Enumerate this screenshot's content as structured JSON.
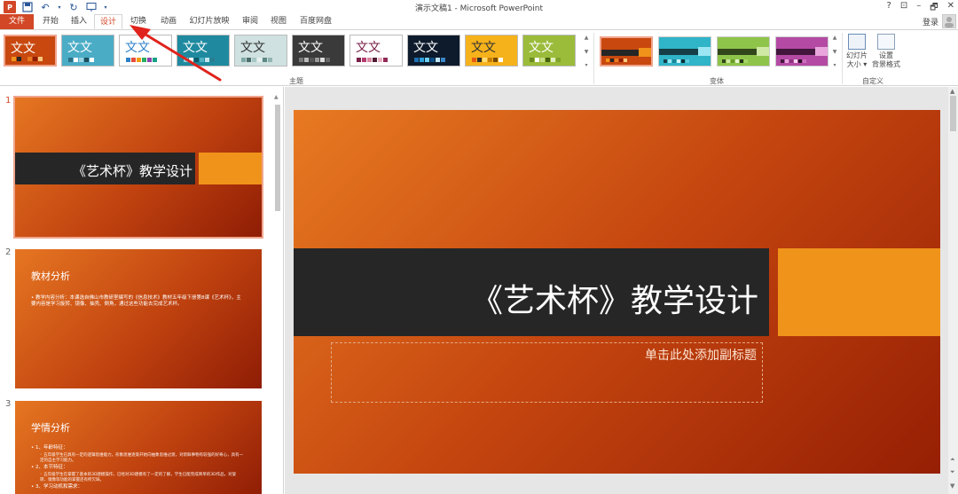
{
  "app": {
    "title": "演示文稿1 - Microsoft PowerPoint",
    "logo_text": "P",
    "window_controls": [
      "?",
      "⊡",
      "–",
      "🗗",
      "✕"
    ]
  },
  "tabs": [
    {
      "label": "文件",
      "kind": "file"
    },
    {
      "label": "开始"
    },
    {
      "label": "插入"
    },
    {
      "label": "设计",
      "active": true
    },
    {
      "label": "切换"
    },
    {
      "label": "动画"
    },
    {
      "label": "幻灯片放映"
    },
    {
      "label": "审阅"
    },
    {
      "label": "视图"
    },
    {
      "label": "百度网盘"
    }
  ],
  "account": {
    "login_label": "登录"
  },
  "ribbon": {
    "themes_group_label": "主题",
    "variants_group_label": "变体",
    "custom_group_label": "自定义",
    "theme_sample_text": "文文",
    "themes": [
      {
        "bg": "#c8480f",
        "fg": "#ffffff",
        "selected": true,
        "swatches": [
          "#f0931a",
          "#262626",
          "#c8480f",
          "#e87a22",
          "#8f1d05",
          "#f7c77f"
        ]
      },
      {
        "bg": "#4bacc6",
        "fg": "#ffffff",
        "swatches": [
          "#2c6e83",
          "#ffffff",
          "#9bd3e2",
          "#1f4e5d",
          "#ffffff",
          "#4bacc6"
        ]
      },
      {
        "bg": "#ffffff",
        "fg": "#2f81c8",
        "swatches": [
          "#2f81c8",
          "#e74c3c",
          "#f39c12",
          "#27ae60",
          "#8e44ad",
          "#16a085"
        ]
      },
      {
        "bg": "#1f8a9f",
        "fg": "#ffffff",
        "swatches": [
          "#8cd0de",
          "#ffffff",
          "#0f5a68",
          "#4fb1c4",
          "#c4e6ee",
          "#2a7d90"
        ]
      },
      {
        "bg": "#cfe1e0",
        "fg": "#333333",
        "swatches": [
          "#7fa8a6",
          "#4b6e6c",
          "#a7c7c5",
          "#e7f0ef",
          "#5d8886",
          "#92b5b3"
        ]
      },
      {
        "bg": "#3a3a3a",
        "fg": "#ffffff",
        "swatches": [
          "#777777",
          "#bbbbbb",
          "#555555",
          "#999999",
          "#dddddd",
          "#666666"
        ]
      },
      {
        "bg": "#ffffff",
        "fg": "#7a2048",
        "swatches": [
          "#7a2048",
          "#b33b6e",
          "#d8889f",
          "#4f1a33",
          "#e9b3c3",
          "#932a58"
        ]
      },
      {
        "bg": "#0e1b2c",
        "fg": "#ffffff",
        "swatches": [
          "#1f6fb2",
          "#2da0d8",
          "#6ccff6",
          "#0a4f86",
          "#bde6f7",
          "#3b86c6"
        ]
      },
      {
        "bg": "#f6b21b",
        "fg": "#333333",
        "swatches": [
          "#e55b13",
          "#2d2d2d",
          "#ffdd7a",
          "#c47d06",
          "#7a4a00",
          "#ffffff"
        ]
      },
      {
        "bg": "#9bbb3a",
        "fg": "#ffffff",
        "swatches": [
          "#6b8a21",
          "#ffffff",
          "#c5dc82",
          "#45600f",
          "#e2eebf",
          "#7fa22d"
        ]
      }
    ],
    "variants": [
      {
        "bg": "#c8480f",
        "band": "#262626",
        "accent": "#f0931a",
        "selected": true,
        "swatches": [
          "#f0931a",
          "#262626",
          "#e87a22",
          "#8f1d05",
          "#f7c77f",
          "#c8480f"
        ]
      },
      {
        "bg": "#2fb4c8",
        "band": "#163e46",
        "accent": "#9be6f2",
        "swatches": [
          "#163e46",
          "#9be6f2",
          "#1b8596",
          "#d2f5fa",
          "#0f2f35",
          "#5ec9d9"
        ]
      },
      {
        "bg": "#8fc44a",
        "band": "#32461c",
        "accent": "#cfe8a3",
        "swatches": [
          "#32461c",
          "#cfe8a3",
          "#6a9b2c",
          "#e7f4d1",
          "#253514",
          "#a6d36a"
        ]
      },
      {
        "bg": "#b44aa4",
        "band": "#42173c",
        "accent": "#e8a6dc",
        "swatches": [
          "#42173c",
          "#e8a6dc",
          "#8d3380",
          "#f5d2ee",
          "#2d0f28",
          "#cb6fbd"
        ]
      }
    ],
    "buttons": [
      {
        "label": "幻灯片\n大小 ▾"
      },
      {
        "label": "设置\n背景格式"
      }
    ]
  },
  "slides": [
    {
      "number": "1",
      "kind": "title",
      "title": "《艺术杯》教学设计",
      "selected": true
    },
    {
      "number": "2",
      "kind": "content",
      "heading": "教材分析",
      "body": [
        "• 教学内容分析：本课选自佛山市教研室编写的《信息技术》教材五年级下册第8课《艺术杯》，主要内容是学习旋转、镜像、抽壳、倒角，通过这些功能去完成艺术杯。"
      ]
    },
    {
      "number": "3",
      "kind": "content",
      "heading": "学情分析",
      "body": [
        "• 1、年龄特征：",
        "  ◦ 五年级学生已具有一定的逻辑思维能力，形象思维逐渐开始向抽象思维过渡，对新鲜事物有较强的好奇心，具有一定的自主学习能力。",
        "• 2、本节特征：",
        "  ◦ 五年级学生在掌握了基本的3D建模操作，已经对3D建模有了一定的了解，学生已能完成简单的3D作品，对旋转、镜像等功能的掌握还有所欠缺。",
        "• 3、学习动机和需求："
      ]
    }
  ],
  "current_slide": {
    "title": "《艺术杯》教学设计",
    "subtitle_placeholder": "单击此处添加副标题"
  }
}
